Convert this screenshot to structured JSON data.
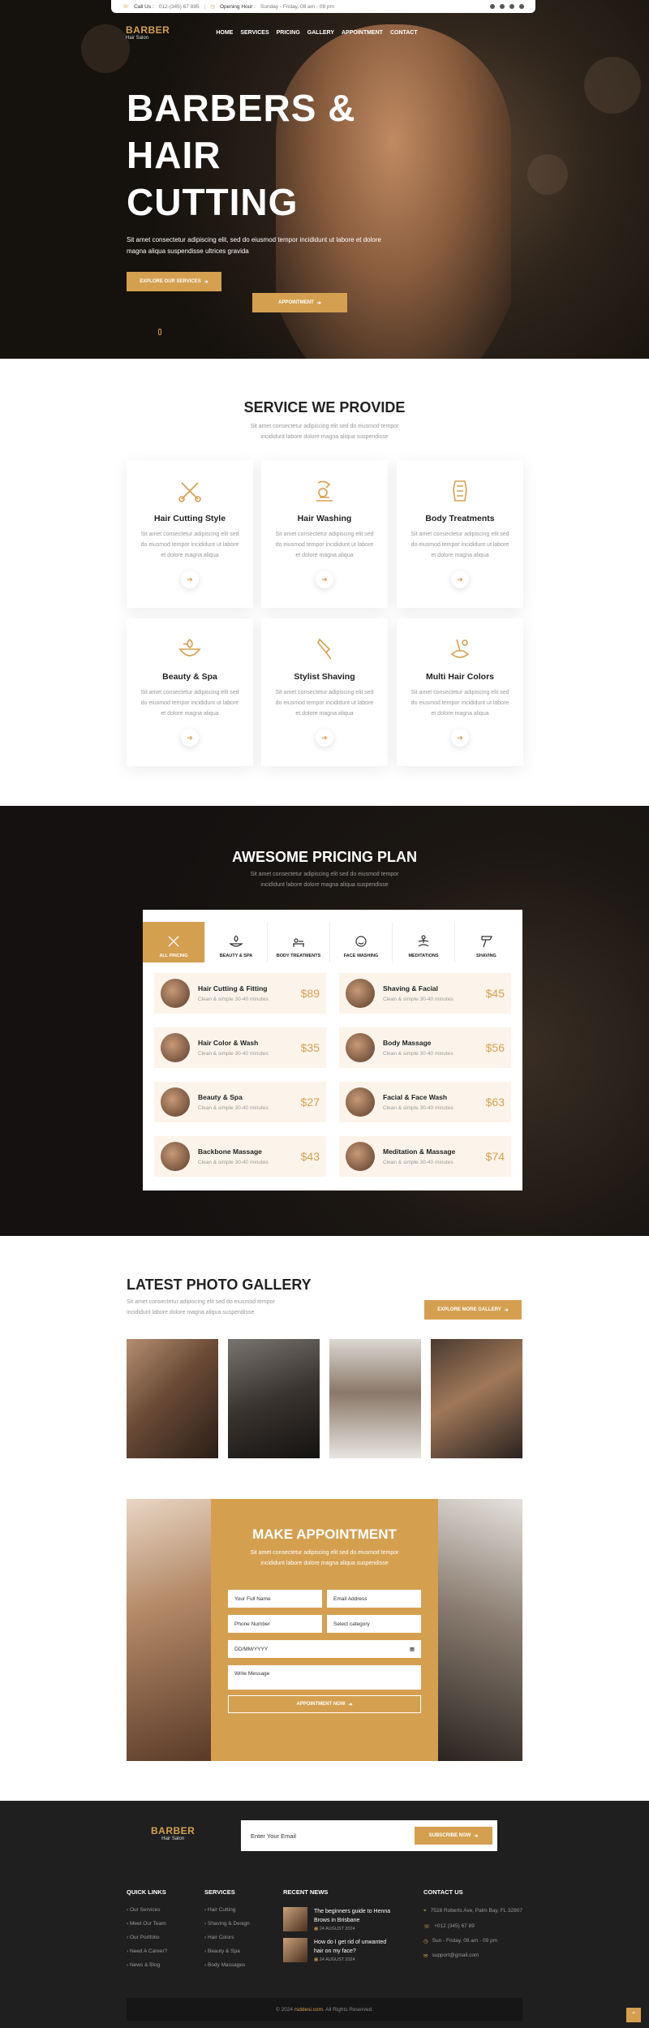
{
  "topbar": {
    "call_label": "Call Us :",
    "call_value": "012-(345) 67 895",
    "hours_label": "Opening Hour :",
    "hours_value": "Sunday - Friday, 08 am - 09 pm"
  },
  "nav": {
    "logo_title": "BARBER",
    "logo_sub": "Hair Salon",
    "items": [
      "HOME",
      "SERVICES",
      "PRICING",
      "GALLERY",
      "APPOINTMENT",
      "CONTACT"
    ],
    "cta": "APPOINTMENT"
  },
  "hero": {
    "line1": "BARBERS &",
    "line2": "HAIR",
    "line3": "CUTTING",
    "text": "Sit amet consectetur adipiscing elit, sed do eiusmod tempor incididunt ut labore et dolore magna aliqua suspendisse ultrices gravida",
    "button": "EXPLORE OUR SERVICES"
  },
  "services": {
    "title": "SERVICE WE PROVIDE",
    "subtitle": "Sit amet consectetur adipiscing elit sed do eiusmod tempor incididunt labore dolore magna aliqua suspendisse",
    "cards": [
      {
        "title": "Hair Cutting Style",
        "text": "Sit amet consectetur adipiscing elit sed do eiusmod tempor incididunt ut labore et dolore magna aliqua"
      },
      {
        "title": "Hair Washing",
        "text": "Sit amet consectetur adipiscing elit sed do eiusmod tempor incididunt ut labore et dolore magna aliqua"
      },
      {
        "title": "Body Treatments",
        "text": "Sit amet consectetur adipiscing elit sed do eiusmod tempor incididunt ut labore et dolore magna aliqua"
      },
      {
        "title": "Beauty & Spa",
        "text": "Sit amet consectetur adipiscing elit sed do eiusmod tempor incididunt ut labore et dolore magna aliqua"
      },
      {
        "title": "Stylist Shaving",
        "text": "Sit amet consectetur adipiscing elit sed do eiusmod tempor incididunt ut labore et dolore magna aliqua"
      },
      {
        "title": "Multi Hair Colors",
        "text": "Sit amet consectetur adipiscing elit sed do eiusmod tempor incididunt ut labore et dolore magna aliqua"
      }
    ]
  },
  "pricing": {
    "title": "AWESOME PRICING PLAN",
    "subtitle": "Sit amet consectetur adipiscing elit sed do eiusmod tempor incididunt labore dolore magna aliqua suspendisse",
    "tabs": [
      "ALL PRICING",
      "BEAUTY & SPA",
      "BODY TREATMENTS",
      "FACE WASHING",
      "MEDITATIONS",
      "SHAVING"
    ],
    "items": [
      {
        "name": "Hair Cutting & Fitting",
        "desc": "Clean & simple 30-40 minutes",
        "price": "$89"
      },
      {
        "name": "Shaving & Facial",
        "desc": "Clean & simple 30-40 minutes",
        "price": "$45"
      },
      {
        "name": "Hair Color & Wash",
        "desc": "Clean & simple 30-40 minutes",
        "price": "$35"
      },
      {
        "name": "Body Massage",
        "desc": "Clean & simple 30-40 minutes",
        "price": "$56"
      },
      {
        "name": "Beauty & Spa",
        "desc": "Clean & simple 30-40 minutes",
        "price": "$27"
      },
      {
        "name": "Facial & Face Wash",
        "desc": "Clean & simple 30-40 minutes",
        "price": "$63"
      },
      {
        "name": "Backbone Massage",
        "desc": "Clean & simple 30-40 minutes",
        "price": "$43"
      },
      {
        "name": "Meditation & Massage",
        "desc": "Clean & simple 30-40 minutes",
        "price": "$74"
      }
    ]
  },
  "gallery": {
    "title": "LATEST PHOTO GALLERY",
    "subtitle": "Sit amet consectetur adipiscing elit sed do eiusmod tempor incididunt labore dolore magna aliqua suspendisse",
    "button": "EXPLORE MORE GALLERY"
  },
  "appointment": {
    "title": "MAKE APPOINTMENT",
    "subtitle": "Sit amet consectetur adipiscing elit sed do eiusmod tempor incididunt labore dolore magna aliqua suspendisse",
    "name_ph": "Your Full Name",
    "email_ph": "Email Address",
    "phone_ph": "Phone Number",
    "category": "Select category",
    "date_ph": "DD/MM/YYYY",
    "message_ph": "Write Message",
    "submit": "APPOINTMENT NOW"
  },
  "footer": {
    "logo_title": "BARBER",
    "logo_sub": "Hair Salon",
    "email_ph": "Enter Your Email",
    "subscribe": "SUBSCRIBE NOW",
    "quick_title": "QUICK LINKS",
    "quick": [
      "Our Services",
      "Meet Our Team",
      "Our Portfolio",
      "Need A Career?",
      "News & Blog"
    ],
    "services_title": "SERVICES",
    "services": [
      "Hair Cutting",
      "Shaving & Design",
      "Hair Colors",
      "Beauty & Spa",
      "Body Massages"
    ],
    "news_title": "RECENT NEWS",
    "news": [
      {
        "title": "The beginners guide to Henna Brows in Brisbane",
        "date": "24 AUGUST 2024"
      },
      {
        "title": "How do I get rid of unwanted hair on my face?",
        "date": "24 AUGUST 2024"
      }
    ],
    "contact_title": "CONTACT US",
    "address": "7528 Roberts Ave, Palm Bay, FL 32907",
    "phone": "+012 (345) 67 89",
    "hours": "Sun - Friday, 08 am - 09 pm",
    "email": "support@gmail.com",
    "copy_pre": "© 2024",
    "copy_brand": "rsddesi.com",
    "copy_post": ". All Rights Reserved."
  },
  "colors": {
    "accent": "#d4a050",
    "dark": "#1f1f1f"
  }
}
